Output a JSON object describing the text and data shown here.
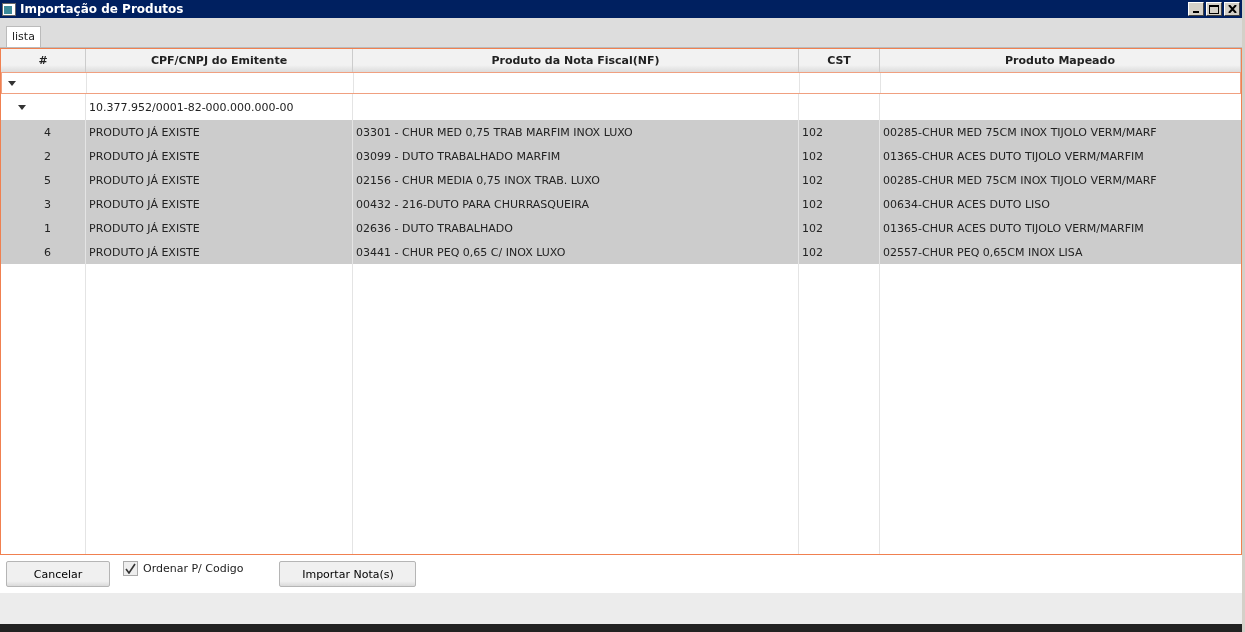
{
  "window": {
    "title": "Importação de Produtos"
  },
  "tabs": [
    {
      "label": "lista",
      "selected": true
    }
  ],
  "table": {
    "columns": [
      "#",
      "CPF/CNPJ do Emitente",
      "Produto da Nota Fiscal(NF)",
      "CST",
      "Produto Mapeado"
    ],
    "filter_row": {
      "expanded": true
    },
    "group": {
      "label": "10.377.952/0001-82-000.000.000-00",
      "expanded": true
    },
    "rows": [
      {
        "num": "4",
        "status": "PRODUTO JÁ EXISTE",
        "produto_nf": "03301 - CHUR MED 0,75 TRAB MARFIM INOX LUXO",
        "cst": "102",
        "produto_mapeado": "00285-CHUR MED 75CM INOX TIJOLO VERM/MARF",
        "selected": true
      },
      {
        "num": "2",
        "status": "PRODUTO JÁ EXISTE",
        "produto_nf": "03099 - DUTO TRABALHADO MARFIM",
        "cst": "102",
        "produto_mapeado": "01365-CHUR ACES DUTO TIJOLO VERM/MARFIM",
        "selected": true
      },
      {
        "num": "5",
        "status": "PRODUTO JÁ EXISTE",
        "produto_nf": "02156 - CHUR MEDIA 0,75 INOX TRAB. LUXO",
        "cst": "102",
        "produto_mapeado": "00285-CHUR MED 75CM INOX TIJOLO VERM/MARF",
        "selected": true
      },
      {
        "num": "3",
        "status": "PRODUTO JÁ EXISTE",
        "produto_nf": "00432 - 216-DUTO PARA CHURRASQUEIRA",
        "cst": "102",
        "produto_mapeado": "00634-CHUR ACES DUTO LISO",
        "selected": true
      },
      {
        "num": "1",
        "status": "PRODUTO JÁ EXISTE",
        "produto_nf": "02636 - DUTO TRABALHADO",
        "cst": "102",
        "produto_mapeado": "01365-CHUR ACES DUTO TIJOLO VERM/MARFIM",
        "selected": true
      },
      {
        "num": "6",
        "status": "PRODUTO JÁ EXISTE",
        "produto_nf": "03441 - CHUR PEQ 0,65 C/ INOX LUXO",
        "cst": "102",
        "produto_mapeado": "02557-CHUR PEQ 0,65CM INOX LISA",
        "selected": true
      }
    ]
  },
  "footer": {
    "cancel_button": "Cancelar",
    "sort_checkbox": {
      "label": "Ordenar P/ Codigo",
      "checked": true
    },
    "import_button": "Importar Nota(s)"
  }
}
